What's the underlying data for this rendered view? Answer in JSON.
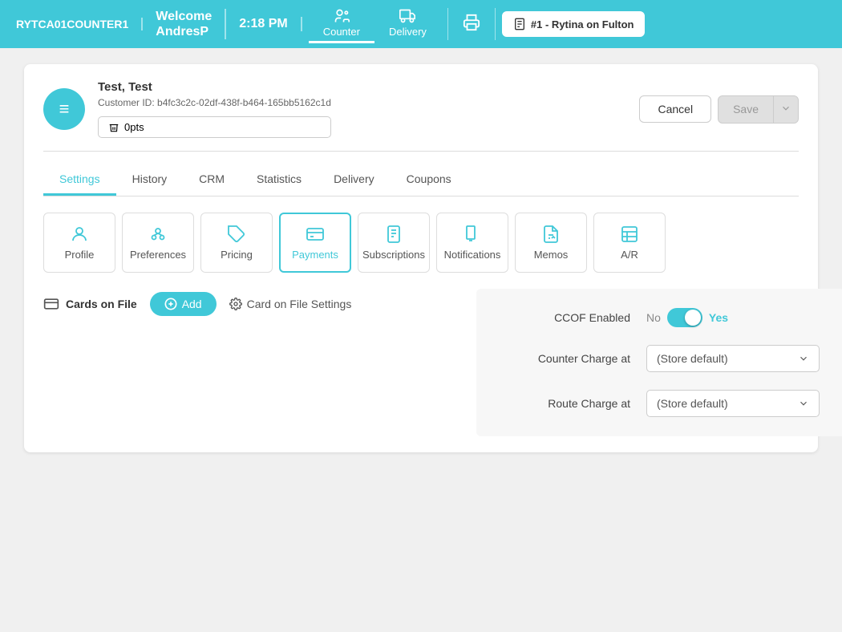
{
  "header": {
    "station": "RYTCA01COUNTER1",
    "welcome_line1": "Welcome",
    "welcome_line2": "AndresP",
    "time": "2:18 PM",
    "nav": [
      {
        "id": "counter",
        "label": "Counter",
        "active": true
      },
      {
        "id": "delivery",
        "label": "Delivery",
        "active": false
      }
    ],
    "location_btn": "#1 - Rytina on Fulton"
  },
  "customer": {
    "name": "Test, Test",
    "customer_id_label": "Customer ID:",
    "customer_id": "b4fc3c2c-02df-438f-b464-165bb5162c1d",
    "avatar_icon": "≡",
    "opts_label": "0pts"
  },
  "actions": {
    "cancel_label": "Cancel",
    "save_label": "Save"
  },
  "tabs": [
    {
      "id": "settings",
      "label": "Settings",
      "active": true
    },
    {
      "id": "history",
      "label": "History",
      "active": false
    },
    {
      "id": "crm",
      "label": "CRM",
      "active": false
    },
    {
      "id": "statistics",
      "label": "Statistics",
      "active": false
    },
    {
      "id": "delivery",
      "label": "Delivery",
      "active": false
    },
    {
      "id": "coupons",
      "label": "Coupons",
      "active": false
    }
  ],
  "sections": [
    {
      "id": "profile",
      "label": "Profile",
      "active": false
    },
    {
      "id": "preferences",
      "label": "Preferences",
      "active": false
    },
    {
      "id": "pricing",
      "label": "Pricing",
      "active": false
    },
    {
      "id": "payments",
      "label": "Payments",
      "active": true
    },
    {
      "id": "subscriptions",
      "label": "Subscriptions",
      "active": false
    },
    {
      "id": "notifications",
      "label": "Notifications",
      "active": false
    },
    {
      "id": "memos",
      "label": "Memos",
      "active": false
    },
    {
      "id": "ar",
      "label": "A/R",
      "active": false
    }
  ],
  "cards_on_file": {
    "label": "Cards on File",
    "add_label": "Add",
    "settings_label": "Card on File Settings"
  },
  "ccof_panel": {
    "ccof_enabled_label": "CCOF Enabled",
    "toggle_no": "No",
    "toggle_yes": "Yes",
    "counter_charge_label": "Counter Charge at",
    "counter_charge_value": "(Store default)",
    "route_charge_label": "Route Charge at",
    "route_charge_value": "(Store default)"
  }
}
